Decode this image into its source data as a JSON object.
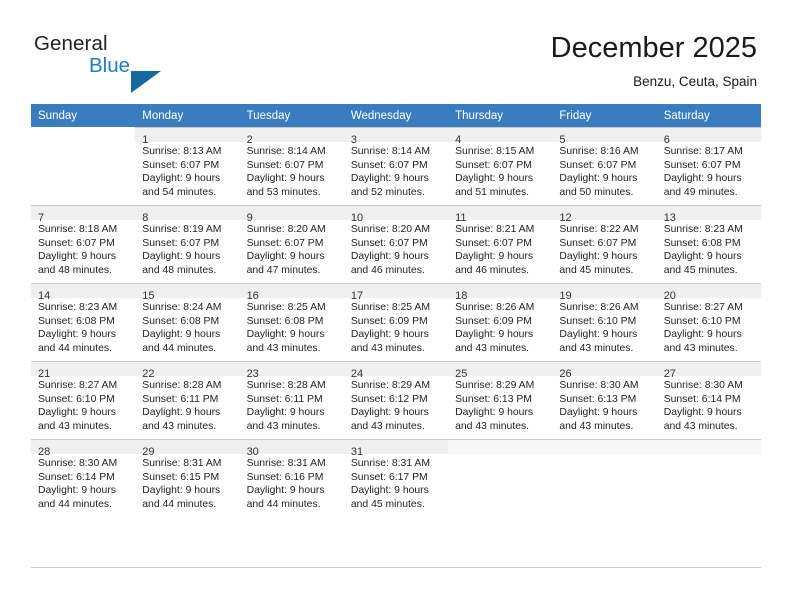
{
  "brand": {
    "line1": "General",
    "line2": "Blue",
    "triangle_color": "#15699f",
    "blue_text_color": "#1f7fc4"
  },
  "header": {
    "title": "December 2025",
    "subtitle": "Benzu, Ceuta, Spain"
  },
  "theme": {
    "header_row_bg": "#3a7cc0",
    "header_row_text": "#ffffff",
    "daynum_band_bg": "#efefef",
    "grid_line": "#c9c9c9"
  },
  "weekdays": [
    "Sunday",
    "Monday",
    "Tuesday",
    "Wednesday",
    "Thursday",
    "Friday",
    "Saturday"
  ],
  "weeks": [
    {
      "days": [
        {
          "num": "",
          "sunrise": "",
          "sunset": "",
          "daylight1": "",
          "daylight2": ""
        },
        {
          "num": "1",
          "sunrise": "Sunrise: 8:13 AM",
          "sunset": "Sunset: 6:07 PM",
          "daylight1": "Daylight: 9 hours",
          "daylight2": "and 54 minutes."
        },
        {
          "num": "2",
          "sunrise": "Sunrise: 8:14 AM",
          "sunset": "Sunset: 6:07 PM",
          "daylight1": "Daylight: 9 hours",
          "daylight2": "and 53 minutes."
        },
        {
          "num": "3",
          "sunrise": "Sunrise: 8:14 AM",
          "sunset": "Sunset: 6:07 PM",
          "daylight1": "Daylight: 9 hours",
          "daylight2": "and 52 minutes."
        },
        {
          "num": "4",
          "sunrise": "Sunrise: 8:15 AM",
          "sunset": "Sunset: 6:07 PM",
          "daylight1": "Daylight: 9 hours",
          "daylight2": "and 51 minutes."
        },
        {
          "num": "5",
          "sunrise": "Sunrise: 8:16 AM",
          "sunset": "Sunset: 6:07 PM",
          "daylight1": "Daylight: 9 hours",
          "daylight2": "and 50 minutes."
        },
        {
          "num": "6",
          "sunrise": "Sunrise: 8:17 AM",
          "sunset": "Sunset: 6:07 PM",
          "daylight1": "Daylight: 9 hours",
          "daylight2": "and 49 minutes."
        }
      ]
    },
    {
      "days": [
        {
          "num": "7",
          "sunrise": "Sunrise: 8:18 AM",
          "sunset": "Sunset: 6:07 PM",
          "daylight1": "Daylight: 9 hours",
          "daylight2": "and 48 minutes."
        },
        {
          "num": "8",
          "sunrise": "Sunrise: 8:19 AM",
          "sunset": "Sunset: 6:07 PM",
          "daylight1": "Daylight: 9 hours",
          "daylight2": "and 48 minutes."
        },
        {
          "num": "9",
          "sunrise": "Sunrise: 8:20 AM",
          "sunset": "Sunset: 6:07 PM",
          "daylight1": "Daylight: 9 hours",
          "daylight2": "and 47 minutes."
        },
        {
          "num": "10",
          "sunrise": "Sunrise: 8:20 AM",
          "sunset": "Sunset: 6:07 PM",
          "daylight1": "Daylight: 9 hours",
          "daylight2": "and 46 minutes."
        },
        {
          "num": "11",
          "sunrise": "Sunrise: 8:21 AM",
          "sunset": "Sunset: 6:07 PM",
          "daylight1": "Daylight: 9 hours",
          "daylight2": "and 46 minutes."
        },
        {
          "num": "12",
          "sunrise": "Sunrise: 8:22 AM",
          "sunset": "Sunset: 6:07 PM",
          "daylight1": "Daylight: 9 hours",
          "daylight2": "and 45 minutes."
        },
        {
          "num": "13",
          "sunrise": "Sunrise: 8:23 AM",
          "sunset": "Sunset: 6:08 PM",
          "daylight1": "Daylight: 9 hours",
          "daylight2": "and 45 minutes."
        }
      ]
    },
    {
      "days": [
        {
          "num": "14",
          "sunrise": "Sunrise: 8:23 AM",
          "sunset": "Sunset: 6:08 PM",
          "daylight1": "Daylight: 9 hours",
          "daylight2": "and 44 minutes."
        },
        {
          "num": "15",
          "sunrise": "Sunrise: 8:24 AM",
          "sunset": "Sunset: 6:08 PM",
          "daylight1": "Daylight: 9 hours",
          "daylight2": "and 44 minutes."
        },
        {
          "num": "16",
          "sunrise": "Sunrise: 8:25 AM",
          "sunset": "Sunset: 6:08 PM",
          "daylight1": "Daylight: 9 hours",
          "daylight2": "and 43 minutes."
        },
        {
          "num": "17",
          "sunrise": "Sunrise: 8:25 AM",
          "sunset": "Sunset: 6:09 PM",
          "daylight1": "Daylight: 9 hours",
          "daylight2": "and 43 minutes."
        },
        {
          "num": "18",
          "sunrise": "Sunrise: 8:26 AM",
          "sunset": "Sunset: 6:09 PM",
          "daylight1": "Daylight: 9 hours",
          "daylight2": "and 43 minutes."
        },
        {
          "num": "19",
          "sunrise": "Sunrise: 8:26 AM",
          "sunset": "Sunset: 6:10 PM",
          "daylight1": "Daylight: 9 hours",
          "daylight2": "and 43 minutes."
        },
        {
          "num": "20",
          "sunrise": "Sunrise: 8:27 AM",
          "sunset": "Sunset: 6:10 PM",
          "daylight1": "Daylight: 9 hours",
          "daylight2": "and 43 minutes."
        }
      ]
    },
    {
      "days": [
        {
          "num": "21",
          "sunrise": "Sunrise: 8:27 AM",
          "sunset": "Sunset: 6:10 PM",
          "daylight1": "Daylight: 9 hours",
          "daylight2": "and 43 minutes."
        },
        {
          "num": "22",
          "sunrise": "Sunrise: 8:28 AM",
          "sunset": "Sunset: 6:11 PM",
          "daylight1": "Daylight: 9 hours",
          "daylight2": "and 43 minutes."
        },
        {
          "num": "23",
          "sunrise": "Sunrise: 8:28 AM",
          "sunset": "Sunset: 6:11 PM",
          "daylight1": "Daylight: 9 hours",
          "daylight2": "and 43 minutes."
        },
        {
          "num": "24",
          "sunrise": "Sunrise: 8:29 AM",
          "sunset": "Sunset: 6:12 PM",
          "daylight1": "Daylight: 9 hours",
          "daylight2": "and 43 minutes."
        },
        {
          "num": "25",
          "sunrise": "Sunrise: 8:29 AM",
          "sunset": "Sunset: 6:13 PM",
          "daylight1": "Daylight: 9 hours",
          "daylight2": "and 43 minutes."
        },
        {
          "num": "26",
          "sunrise": "Sunrise: 8:30 AM",
          "sunset": "Sunset: 6:13 PM",
          "daylight1": "Daylight: 9 hours",
          "daylight2": "and 43 minutes."
        },
        {
          "num": "27",
          "sunrise": "Sunrise: 8:30 AM",
          "sunset": "Sunset: 6:14 PM",
          "daylight1": "Daylight: 9 hours",
          "daylight2": "and 43 minutes."
        }
      ]
    },
    {
      "days": [
        {
          "num": "28",
          "sunrise": "Sunrise: 8:30 AM",
          "sunset": "Sunset: 6:14 PM",
          "daylight1": "Daylight: 9 hours",
          "daylight2": "and 44 minutes."
        },
        {
          "num": "29",
          "sunrise": "Sunrise: 8:31 AM",
          "sunset": "Sunset: 6:15 PM",
          "daylight1": "Daylight: 9 hours",
          "daylight2": "and 44 minutes."
        },
        {
          "num": "30",
          "sunrise": "Sunrise: 8:31 AM",
          "sunset": "Sunset: 6:16 PM",
          "daylight1": "Daylight: 9 hours",
          "daylight2": "and 44 minutes."
        },
        {
          "num": "31",
          "sunrise": "Sunrise: 8:31 AM",
          "sunset": "Sunset: 6:17 PM",
          "daylight1": "Daylight: 9 hours",
          "daylight2": "and 45 minutes."
        },
        {
          "num": "",
          "sunrise": "",
          "sunset": "",
          "daylight1": "",
          "daylight2": ""
        },
        {
          "num": "",
          "sunrise": "",
          "sunset": "",
          "daylight1": "",
          "daylight2": ""
        },
        {
          "num": "",
          "sunrise": "",
          "sunset": "",
          "daylight1": "",
          "daylight2": ""
        }
      ]
    }
  ]
}
